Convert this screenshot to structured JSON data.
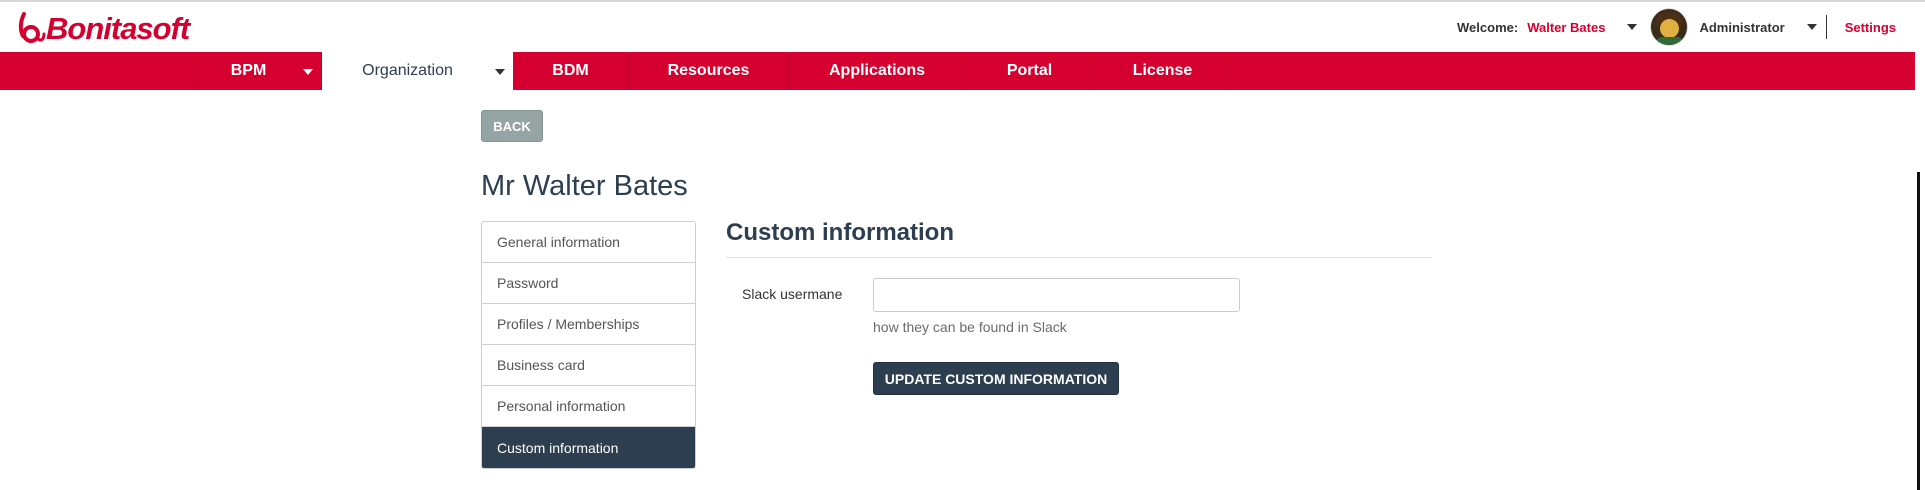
{
  "app": {
    "logo_text": "Bonitasoft"
  },
  "header": {
    "welcome_label": "Welcome:",
    "user_name": "Walter Bates",
    "profile_label": "Administrator",
    "settings_label": "Settings"
  },
  "nav": {
    "items": [
      {
        "label": "BPM",
        "has_dropdown": true,
        "active": false
      },
      {
        "label": "Organization",
        "has_dropdown": true,
        "active": true
      },
      {
        "label": "BDM",
        "has_dropdown": false,
        "active": false
      },
      {
        "label": "Resources",
        "has_dropdown": false,
        "active": false
      },
      {
        "label": "Applications",
        "has_dropdown": false,
        "active": false
      },
      {
        "label": "Portal",
        "has_dropdown": false,
        "active": false
      },
      {
        "label": "License",
        "has_dropdown": false,
        "active": false
      }
    ]
  },
  "page": {
    "back_label": "BACK",
    "title": "Mr Walter Bates"
  },
  "side_menu": {
    "items": [
      {
        "label": "General information",
        "active": false
      },
      {
        "label": "Password",
        "active": false
      },
      {
        "label": "Profiles / Memberships",
        "active": false
      },
      {
        "label": "Business card",
        "active": false
      },
      {
        "label": "Personal information",
        "active": false
      },
      {
        "label": "Custom information",
        "active": true
      }
    ]
  },
  "form": {
    "section_title": "Custom information",
    "field_label": "Slack usermane",
    "field_value": "",
    "field_placeholder": "",
    "help_text": "how they can be found in Slack",
    "submit_label": "UPDATE CUSTOM INFORMATION"
  },
  "icons": {
    "logo": "bonita-logo-icon",
    "user_dropdown": "chevron-down-icon",
    "avatar": "user-avatar-icon",
    "profile_dropdown": "chevron-down-icon"
  },
  "colors": {
    "brand": "#d5002f",
    "dark": "#2c3e50",
    "back_button": "#95a5a6"
  }
}
